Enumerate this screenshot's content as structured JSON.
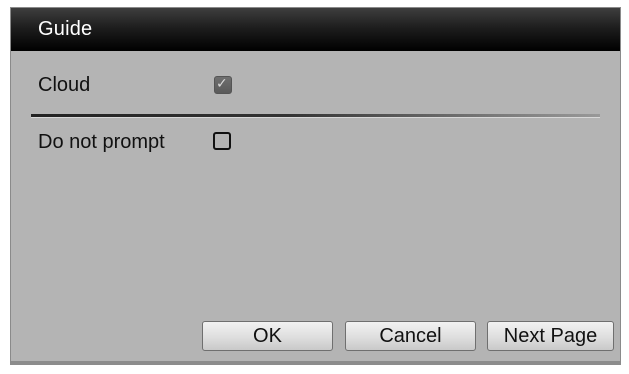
{
  "dialog": {
    "title": "Guide",
    "cloud": {
      "label": "Cloud",
      "checked": true
    },
    "do_not_prompt": {
      "label": "Do not prompt",
      "checked": false
    },
    "buttons": {
      "ok": "OK",
      "cancel": "Cancel",
      "next": "Next Page"
    }
  },
  "icons": {
    "check": "✓"
  }
}
